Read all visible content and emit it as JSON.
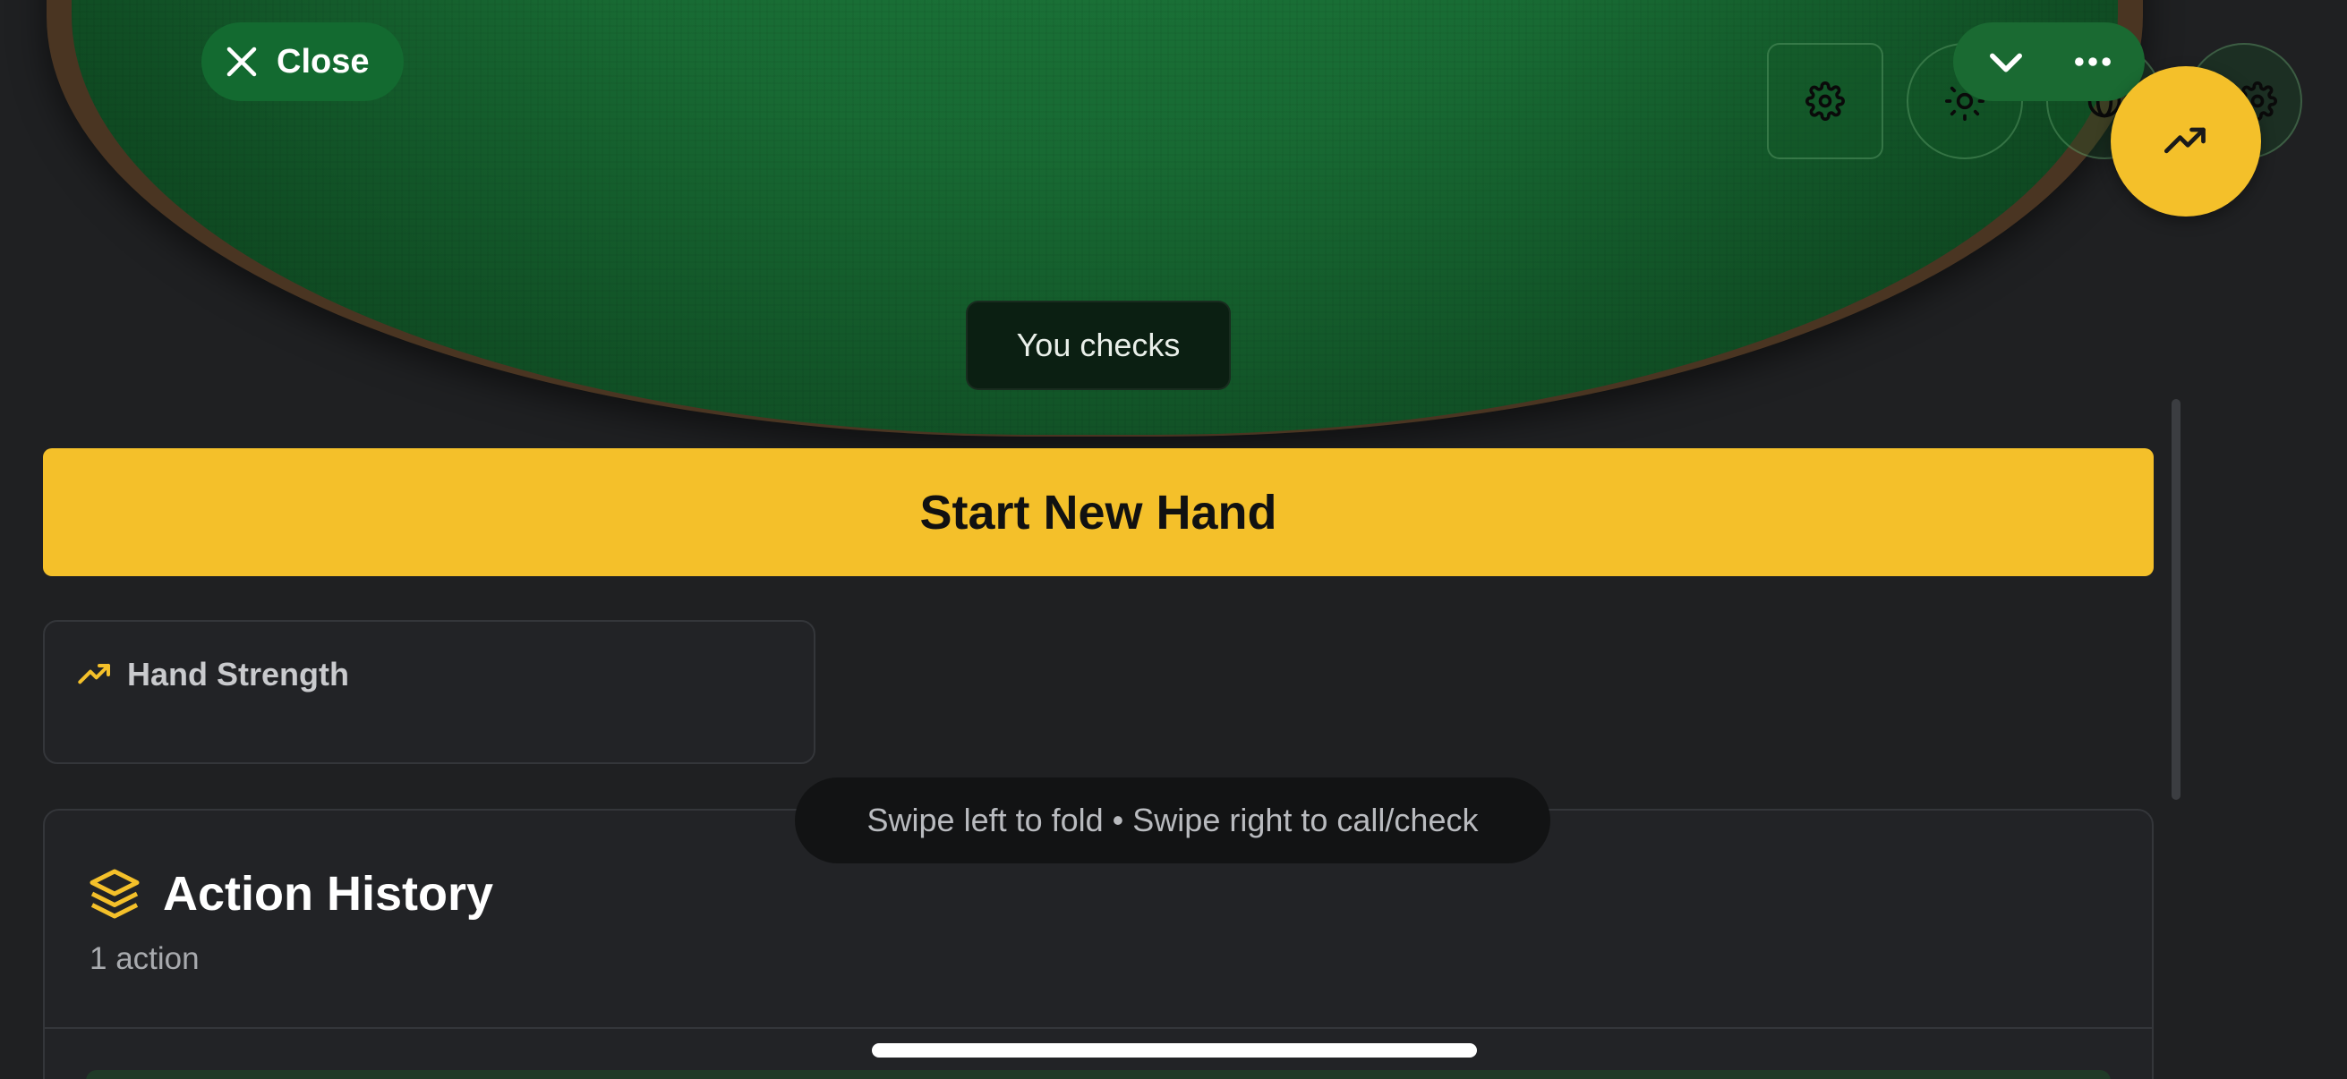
{
  "table": {
    "toast_text": "You checks",
    "felt_color": "#1a7236",
    "rim_color": "#4a3522"
  },
  "header": {
    "close_label": "Close",
    "controls": [
      {
        "icon": "gear-icon"
      },
      {
        "icon": "sun-icon"
      },
      {
        "icon": "globe-icon"
      },
      {
        "icon": "gear-icon"
      }
    ],
    "menu_icons": [
      "chevron-down-icon",
      "more-horizontal-icon"
    ],
    "fab_icon": "trending-up-icon"
  },
  "actions": {
    "start_label": "Start New Hand",
    "accent_color": "#f4c02a"
  },
  "hand_strength": {
    "title": "Hand Strength",
    "icon": "trending-up-icon"
  },
  "swipe_hint": {
    "text": "Swipe left to fold • Swipe right to call/check"
  },
  "history": {
    "title": "Action History",
    "count_label": "1 action",
    "icon": "layers-icon"
  }
}
